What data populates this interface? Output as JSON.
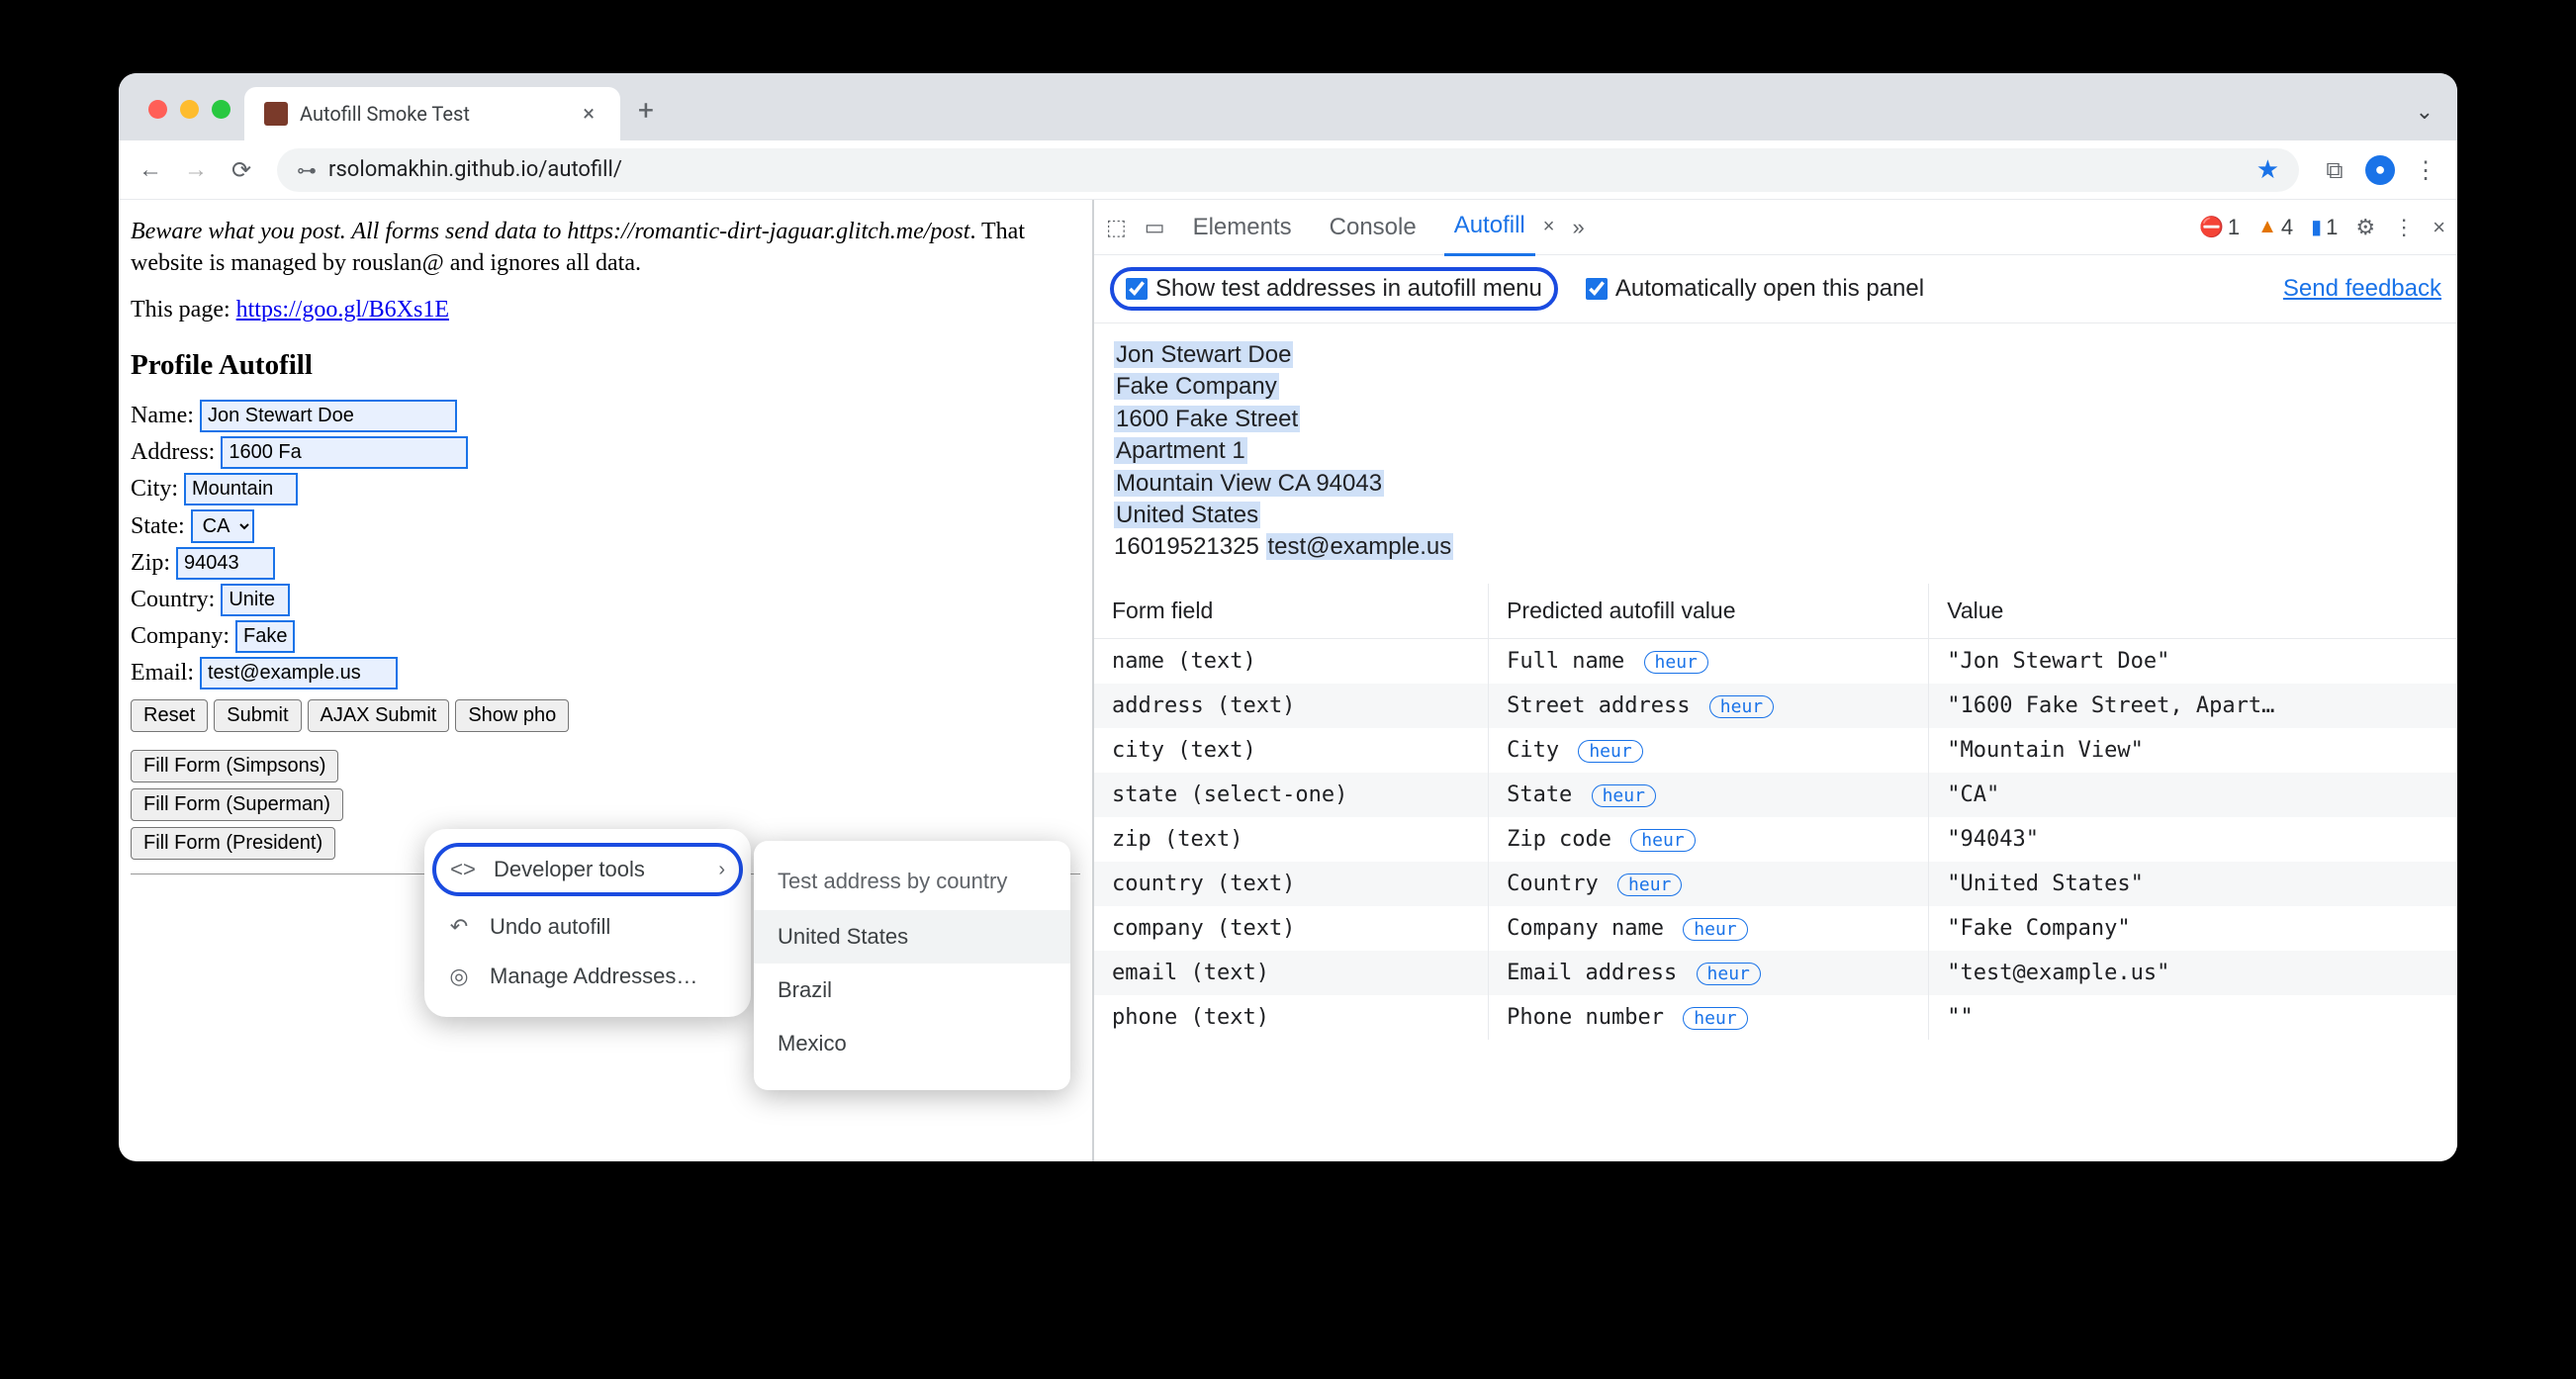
{
  "tab": {
    "title": "Autofill Smoke Test"
  },
  "url": "rsolomakhin.github.io/autofill/",
  "page": {
    "warn_prefix": "Beware what you post. All forms send data to https://romantic-dirt-jaguar.glitch.me/post",
    "warn_suffix": ". That website is managed by rouslan@ and ignores all data.",
    "this_page_label": "This page: ",
    "this_page_link": "https://goo.gl/B6Xs1E",
    "heading": "Profile Autofill",
    "fields": {
      "name_label": "Name:",
      "name_val": "Jon Stewart Doe",
      "address_label": "Address:",
      "address_val": "1600 Fa",
      "city_label": "City:",
      "city_val": "Mountain",
      "state_label": "State:",
      "state_val": "CA",
      "zip_label": "Zip:",
      "zip_val": "94043",
      "country_label": "Country:",
      "country_val": "Unite",
      "company_label": "Company:",
      "company_val": "Fake",
      "email_label": "Email:",
      "email_val": "test@example.us"
    },
    "buttons": {
      "reset": "Reset",
      "submit": "Submit",
      "ajax": "AJAX Submit",
      "phone": "Show pho"
    },
    "fill": {
      "simpsons": "Fill Form (Simpsons)",
      "superman": "Fill Form (Superman)",
      "president": "Fill Form (President)"
    }
  },
  "ctx": {
    "devtools": "Developer tools",
    "undo": "Undo autofill",
    "manage": "Manage Addresses…",
    "submenu_head": "Test address by country",
    "countries": [
      "United States",
      "Brazil",
      "Mexico"
    ]
  },
  "dt": {
    "panels": {
      "elements": "Elements",
      "console": "Console",
      "autofill": "Autofill"
    },
    "counts": {
      "err": "1",
      "warn": "4",
      "info": "1"
    },
    "opts": {
      "show_test": "Show test addresses in autofill menu",
      "auto_open": "Automatically open this panel",
      "feedback": "Send feedback"
    },
    "address": {
      "name": "Jon Stewart Doe",
      "company": "Fake Company",
      "street": "1600 Fake Street",
      "apt": "Apartment 1",
      "city_line": "Mountain View CA 94043",
      "country": "United States",
      "phone": "16019521325",
      "email": "test@example.us"
    },
    "table": {
      "cols": {
        "field": "Form field",
        "pred": "Predicted autofill value",
        "val": "Value"
      },
      "rows": [
        {
          "field": "name (text)",
          "pred": "Full name",
          "val": "\"Jon Stewart Doe\""
        },
        {
          "field": "address (text)",
          "pred": "Street address",
          "val": "\"1600 Fake Street, Apart…"
        },
        {
          "field": "city (text)",
          "pred": "City",
          "val": "\"Mountain View\""
        },
        {
          "field": "state (select-one)",
          "pred": "State",
          "val": "\"CA\""
        },
        {
          "field": "zip (text)",
          "pred": "Zip code",
          "val": "\"94043\""
        },
        {
          "field": "country (text)",
          "pred": "Country",
          "val": "\"United States\""
        },
        {
          "field": "company (text)",
          "pred": "Company name",
          "val": "\"Fake Company\""
        },
        {
          "field": "email (text)",
          "pred": "Email address",
          "val": "\"test@example.us\""
        },
        {
          "field": "phone (text)",
          "pred": "Phone number",
          "val": "\"\""
        }
      ],
      "heur": "heur"
    }
  }
}
